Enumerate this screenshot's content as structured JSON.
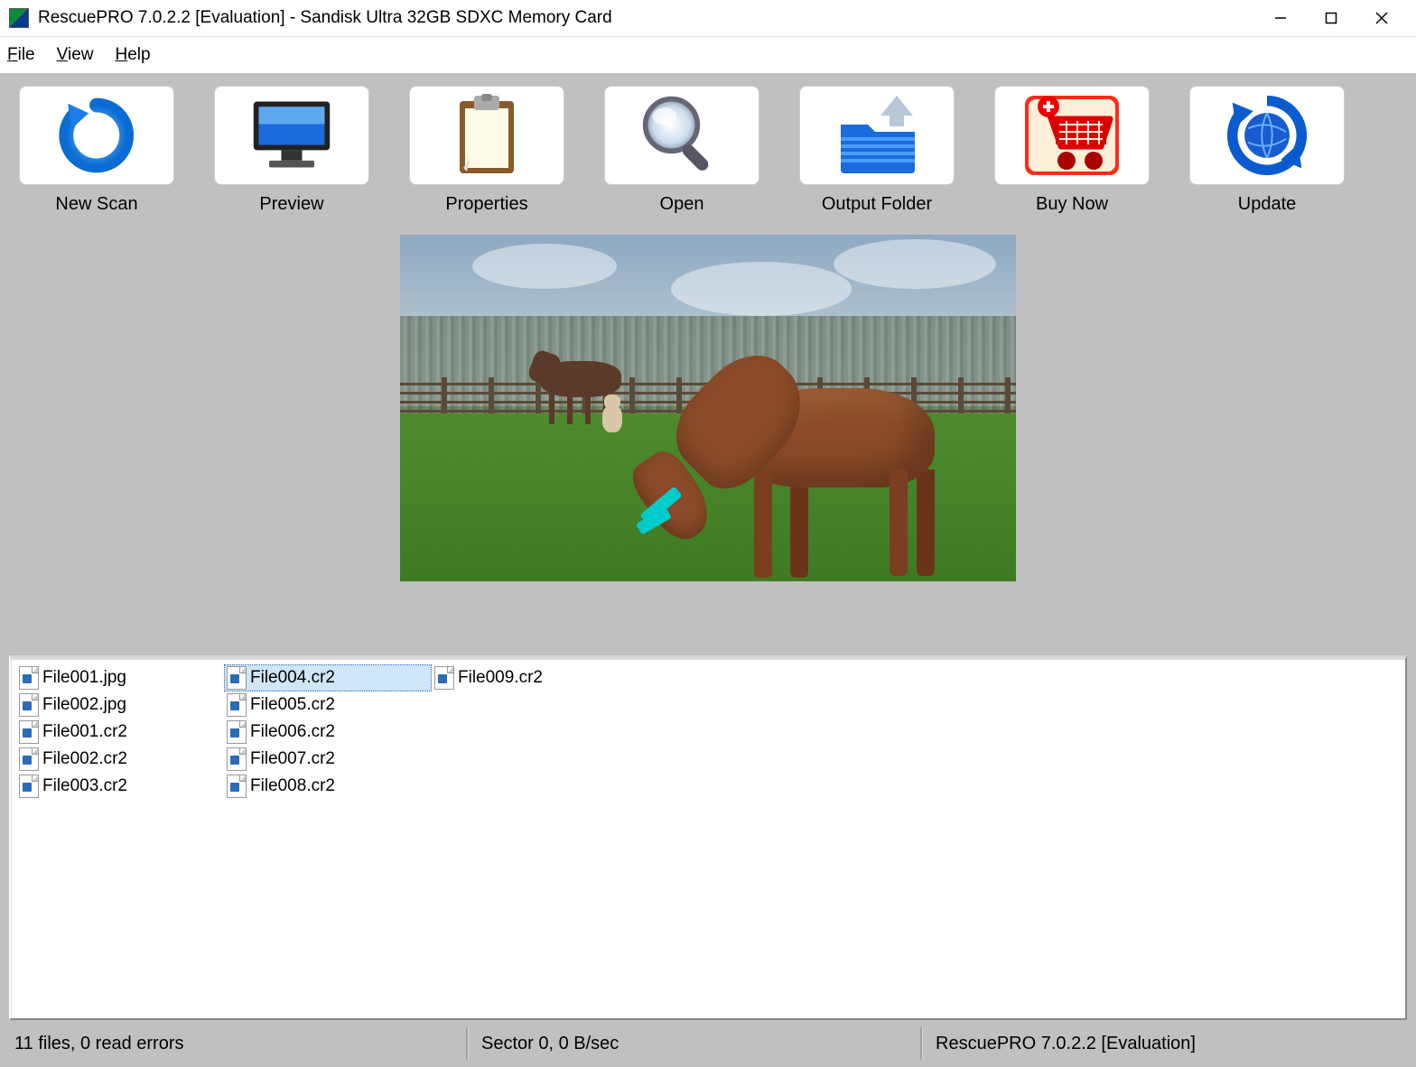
{
  "window": {
    "title": "RescuePRO 7.0.2.2 [Evaluation] - Sandisk Ultra 32GB SDXC Memory Card"
  },
  "menu": {
    "file": "File",
    "view": "View",
    "help": "Help"
  },
  "toolbar": {
    "new_scan": "New Scan",
    "preview": "Preview",
    "properties": "Properties",
    "open": "Open",
    "output_folder": "Output Folder",
    "buy_now": "Buy Now",
    "update": "Update"
  },
  "files": [
    {
      "name": "File001.jpg",
      "selected": false
    },
    {
      "name": "File002.jpg",
      "selected": false
    },
    {
      "name": "File001.cr2",
      "selected": false
    },
    {
      "name": "File002.cr2",
      "selected": false
    },
    {
      "name": "File003.cr2",
      "selected": false
    },
    {
      "name": "File004.cr2",
      "selected": true
    },
    {
      "name": "File005.cr2",
      "selected": false
    },
    {
      "name": "File006.cr2",
      "selected": false
    },
    {
      "name": "File007.cr2",
      "selected": false
    },
    {
      "name": "File008.cr2",
      "selected": false
    },
    {
      "name": "File009.cr2",
      "selected": false
    }
  ],
  "status": {
    "left": "11 files, 0 read errors",
    "center": "Sector 0, 0 B/sec",
    "right": "RescuePRO 7.0.2.2 [Evaluation]"
  }
}
